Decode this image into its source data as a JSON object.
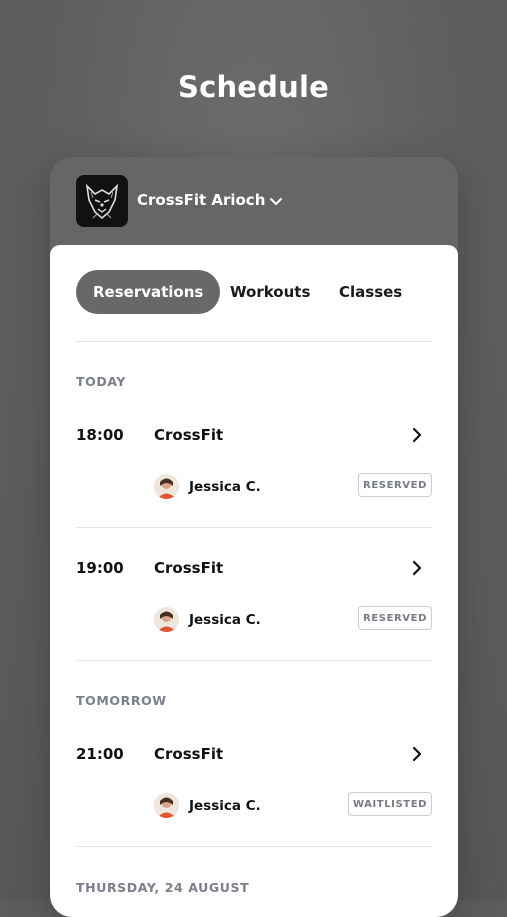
{
  "page": {
    "title": "Schedule"
  },
  "gym": {
    "name": "CrossFit Arioch"
  },
  "tabs": [
    {
      "label": "Reservations",
      "active": true
    },
    {
      "label": "Workouts",
      "active": false
    },
    {
      "label": "Classes",
      "active": false
    }
  ],
  "sections": [
    {
      "label": "TODAY",
      "items": [
        {
          "time": "18:00",
          "class": "CrossFit",
          "person": "Jessica C.",
          "status": "RESERVED"
        },
        {
          "time": "19:00",
          "class": "CrossFit",
          "person": "Jessica C.",
          "status": "RESERVED"
        }
      ]
    },
    {
      "label": "TOMORROW",
      "items": [
        {
          "time": "21:00",
          "class": "CrossFit",
          "person": "Jessica C.",
          "status": "WAITLISTED"
        }
      ]
    },
    {
      "label": "THURSDAY, 24 AUGUST",
      "items": []
    }
  ],
  "icons": {
    "gym_switch": "chevron-down-icon",
    "row_open": "chevron-right-icon",
    "logo": "wolf-logo-icon"
  },
  "colors": {
    "background": "#5f5f5f",
    "header_card": "#666666",
    "active_tab": "#686868",
    "badge_border": "#c9ccd3",
    "section_label": "#7b7f8a"
  }
}
